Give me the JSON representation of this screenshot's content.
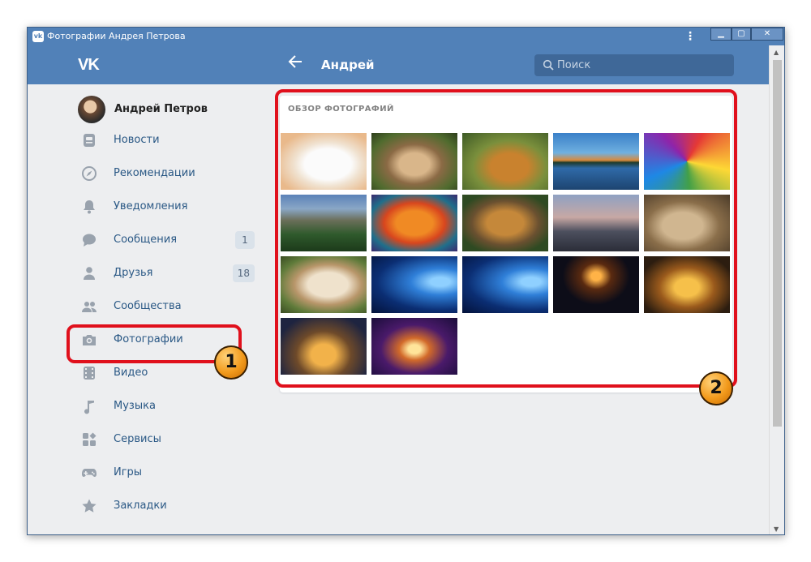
{
  "window": {
    "title": "Фотографии Андрея Петрова"
  },
  "header": {
    "logo": "VK",
    "title": "Андрей"
  },
  "search": {
    "placeholder": "Поиск"
  },
  "profile": {
    "name": "Андрей Петров"
  },
  "nav": [
    {
      "label": "Новости",
      "icon": "newspaper-icon"
    },
    {
      "label": "Рекомендации",
      "icon": "compass-icon"
    },
    {
      "label": "Уведомления",
      "icon": "bell-icon"
    },
    {
      "label": "Сообщения",
      "icon": "chat-bubble-icon",
      "badge": "1"
    },
    {
      "label": "Друзья",
      "icon": "person-icon",
      "badge": "18"
    },
    {
      "label": "Сообщества",
      "icon": "people-icon"
    },
    {
      "label": "Фотографии",
      "icon": "camera-icon"
    },
    {
      "label": "Видео",
      "icon": "film-icon"
    },
    {
      "label": "Музыка",
      "icon": "music-note-icon"
    },
    {
      "label": "Сервисы",
      "icon": "grid-icon"
    },
    {
      "label": "Игры",
      "icon": "gamepad-icon"
    },
    {
      "label": "Закладки",
      "icon": "star-icon"
    }
  ],
  "photos": {
    "title": "ОБЗОР ФОТОГРАФИЙ",
    "items": [
      "white-fox-photo",
      "cougar-cub-photo",
      "dog-lying-photo",
      "lake-sunset-photo",
      "colorful-cat-art-photo",
      "mountain-valley-photo",
      "tiger-art-photo",
      "lion-photo",
      "railway-anime-photo",
      "dog-with-goggles-photo",
      "pug-photo",
      "windows-wallpaper-photo",
      "windows-wallpaper-photo",
      "city-fireworks-photo",
      "lit-house-photo",
      "christmas-house-photo",
      "christmas-tree-photo"
    ]
  },
  "annotations": [
    "1",
    "2"
  ],
  "colors": {
    "header": "#5181b8",
    "accent_red": "#e0101c",
    "link": "#2a5885"
  }
}
